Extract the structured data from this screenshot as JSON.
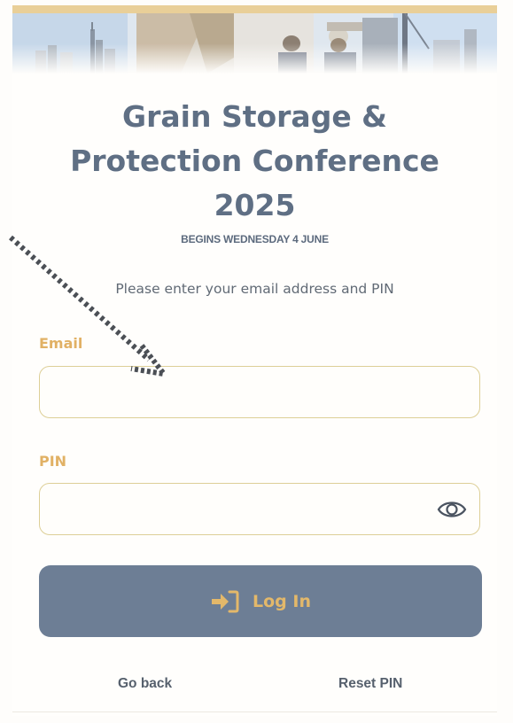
{
  "header": {
    "title": "Grain Storage & Protection Conference 2025",
    "begins": "BEGINS WEDNESDAY 4 JUNE"
  },
  "form": {
    "prompt": "Please enter your email address and PIN",
    "email_label": "Email",
    "email_value": "",
    "pin_label": "PIN",
    "pin_value": "",
    "login_label": "Log In"
  },
  "links": {
    "go_back": "Go back",
    "reset_pin": "Reset PIN"
  },
  "icons": {
    "password_toggle": "eye-icon",
    "login": "sign-in-icon",
    "annotation": "dotted-arrow-icon"
  },
  "colors": {
    "title": "#5f6f84",
    "accent": "#e1b165",
    "button_bg": "#6d7e95",
    "field_border": "#ddcf97"
  }
}
